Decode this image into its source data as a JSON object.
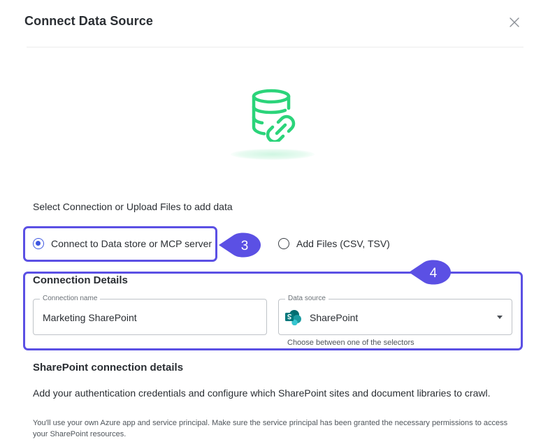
{
  "dialog": {
    "title": "Connect Data Source",
    "close_icon": "close-icon"
  },
  "hero": {
    "icon": "database-link-icon",
    "accent_color": "#2bd47a"
  },
  "source_selection": {
    "label": "Select Connection or Upload Files to add data",
    "options": [
      {
        "label": "Connect to Data store or MCP server",
        "selected": true
      },
      {
        "label": "Add Files (CSV, TSV)",
        "selected": false
      }
    ]
  },
  "annotations": {
    "step_a": "3",
    "step_b": "4",
    "highlight_color": "#5b50e4"
  },
  "connection_details": {
    "title": "Connection Details",
    "name_field": {
      "label": "Connection name",
      "value": "Marketing SharePoint"
    },
    "source_field": {
      "label": "Data source",
      "value": "SharePoint",
      "icon": "sharepoint-logo-icon"
    },
    "helper_text": "Choose between one of the selectors"
  },
  "sharepoint": {
    "title": "SharePoint connection details",
    "description": "Add your authentication credentials and configure which SharePoint sites and document libraries to crawl.",
    "note": "You'll use your own Azure app and service principal. Make sure the service principal has been granted the necessary permissions to access your SharePoint resources."
  }
}
